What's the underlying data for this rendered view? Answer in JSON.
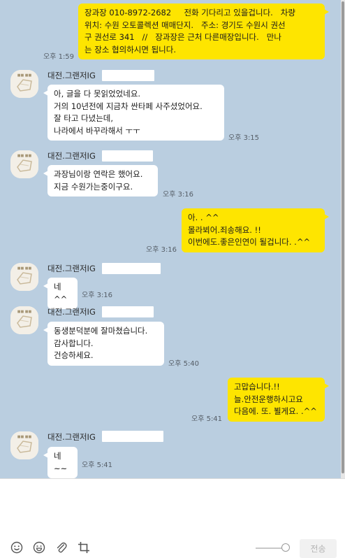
{
  "messages": [
    {
      "text": "장과장 010-8972-2682     전화 기다리고 있을겁니다.   차량\n위치: 수원 오토콜렉션 매매단지.   주소: 경기도 수원시 권선\n구 권선로 341   //   장과장은 근처 다른매장입니다.   만나\n는 장소 협의하시면 됩니다.",
      "time": "오후 1:59"
    },
    {
      "sender": "대전.그랜저IG",
      "text": "아, 글을 다 못읽었었네요.\n거의 10년전에 지금차 싼타페 사주셨었어요.\n잘 타고 다녔는데,\n나라에서 바꾸라해서 ㅜㅜ",
      "time": "오후 3:15"
    },
    {
      "sender": "대전.그랜저IG",
      "text": "과장님이랑 연락은 했어요.\n지금 수원가는중이구요.",
      "time": "오후 3:16"
    },
    {
      "text": "아. . ^^\n몰라뵈어.죄송해요. !!\n이번에도.좋은인연이 될겁니다. .^^",
      "time": "오후 3:16"
    },
    {
      "sender": "대전.그랜저IG",
      "text": "네^^",
      "time": "오후 3:16"
    },
    {
      "sender": "대전.그랜저IG",
      "text": "동생분덕분에 잘마쳤습니다.\n감사합니다.\n건승하세요.",
      "time": "오후 5:40"
    },
    {
      "text": "고맙습니다.!!\n늘.안전운행하시고요\n다음에. 또. 뵐게요. .^^",
      "time": "오후 5:41"
    },
    {
      "sender": "대전.그랜저IG",
      "text": "네~~",
      "time": "오후 5:41"
    }
  ],
  "compose": {
    "placeholder": "",
    "send_label": "전송"
  },
  "colors": {
    "chat_background": "#bacee0",
    "my_bubble": "#fee500",
    "their_bubble": "#ffffff"
  },
  "icons": [
    "emoticon-icon",
    "sticker-icon",
    "attach-icon",
    "crop-icon"
  ]
}
